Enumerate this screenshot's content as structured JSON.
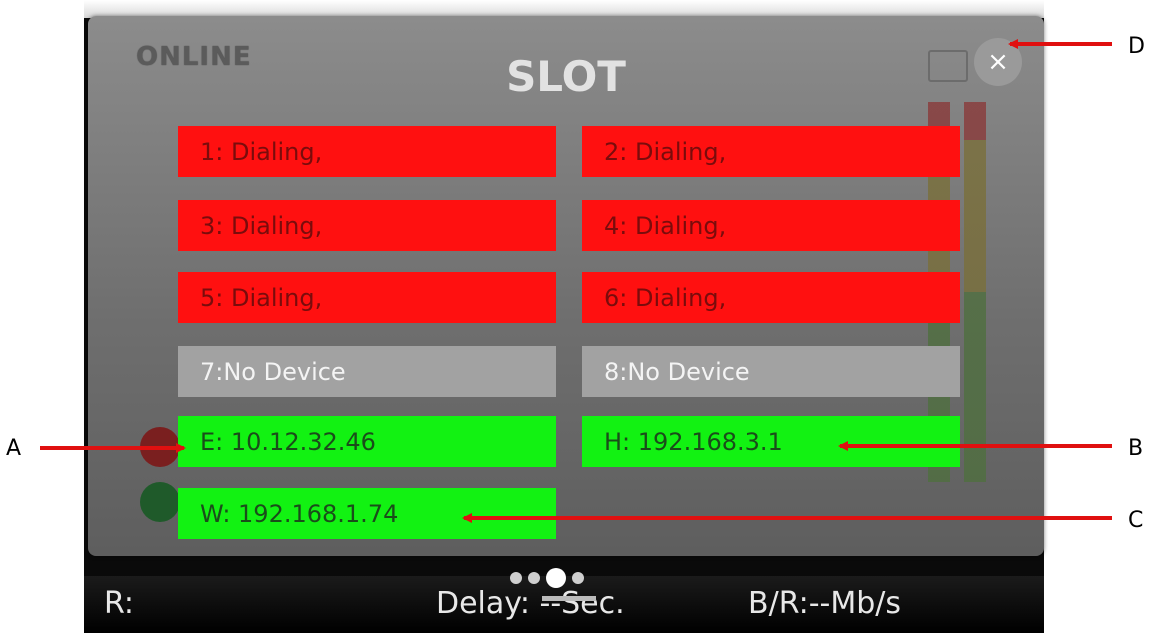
{
  "background": {
    "online_text": "ONLINE"
  },
  "status_bar": {
    "r_label": "R:",
    "delay_label": "Delay: --Sec.",
    "bitrate_label": "B/R:--Mb/s"
  },
  "modal": {
    "title": "SLOT",
    "close_label": "×",
    "slots": [
      {
        "label": "1: Dialing,",
        "state": "dialing"
      },
      {
        "label": "2: Dialing,",
        "state": "dialing"
      },
      {
        "label": "3: Dialing,",
        "state": "dialing"
      },
      {
        "label": "4: Dialing,",
        "state": "dialing"
      },
      {
        "label": "5: Dialing,",
        "state": "dialing"
      },
      {
        "label": "6: Dialing,",
        "state": "dialing"
      },
      {
        "label": "7:No Device",
        "state": "none"
      },
      {
        "label": "8:No Device",
        "state": "none"
      },
      {
        "label": "E: 10.12.32.46",
        "state": "connected"
      },
      {
        "label": "H: 192.168.3.1",
        "state": "connected"
      },
      {
        "label": "W: 192.168.1.74",
        "state": "connected"
      }
    ]
  },
  "callouts": {
    "a": "A",
    "b": "B",
    "c": "C",
    "d": "D"
  },
  "colors": {
    "dialing": "#ff1010",
    "no_device": "#a2a2a2",
    "connected": "#12f212",
    "arrow": "#e01010"
  }
}
